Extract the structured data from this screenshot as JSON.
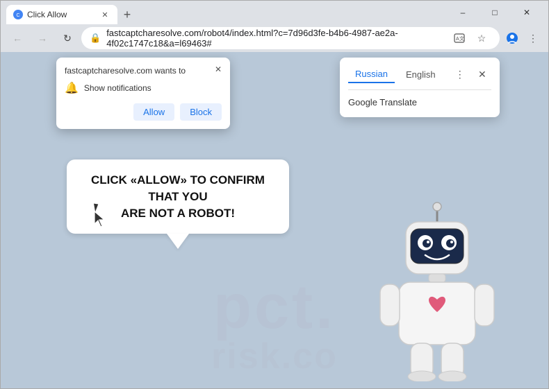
{
  "window": {
    "title": "Click Allow",
    "min_label": "–",
    "max_label": "□",
    "close_label": "✕"
  },
  "tabs": [
    {
      "label": "Click Allow",
      "active": true
    }
  ],
  "new_tab_label": "+",
  "address_bar": {
    "url": "fastcaptcharesolve.com/robot4/index.html?c=7d96d3fe-b4b6-4987-ae2a-4f02c1747c18&a=l69463#",
    "lock_icon": "🔒"
  },
  "notification_popup": {
    "domain": "fastcaptcharesolve.com wants to",
    "row_text": "Show notifications",
    "allow_label": "Allow",
    "block_label": "Block",
    "close_label": "✕"
  },
  "translate_popup": {
    "lang1": "Russian",
    "lang2": "English",
    "item1": "Google Translate",
    "close_label": "✕",
    "more_label": "⋮"
  },
  "speech_bubble": {
    "line1": "CLICK «ALLOW» TO CONFIRM THAT YOU",
    "line2": "ARE NOT A ROBOT!"
  },
  "watermark": {
    "line1": "pct.",
    "line2": "risk.co"
  },
  "nav": {
    "back": "←",
    "forward": "→",
    "reload": "↻"
  }
}
